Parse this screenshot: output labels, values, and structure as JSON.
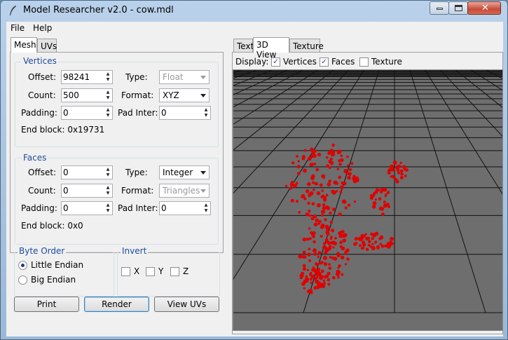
{
  "window": {
    "title": "Model Researcher v2.0 - cow.mdl"
  },
  "menu": {
    "file": "File",
    "help": "Help"
  },
  "left_tabs": {
    "mesh": "Mesh",
    "uvs": "UVs"
  },
  "vertices": {
    "group_label": "Vertices",
    "offset_label": "Offset:",
    "offset_value": "98241",
    "count_label": "Count:",
    "count_value": "500",
    "padding_label": "Padding:",
    "padding_value": "0",
    "type_label": "Type:",
    "type_value": "Float",
    "format_label": "Format:",
    "format_value": "XYZ",
    "padinter_label": "Pad Inter:",
    "padinter_value": "0",
    "endblock_text": "End block: 0x19731"
  },
  "faces": {
    "group_label": "Faces",
    "offset_label": "Offset:",
    "offset_value": "0",
    "count_label": "Count:",
    "count_value": "0",
    "padding_label": "Padding:",
    "padding_value": "0",
    "type_label": "Type:",
    "type_value": "Integer",
    "format_label": "Format:",
    "format_value": "Triangles",
    "padinter_label": "Pad Inter:",
    "padinter_value": "0",
    "endblock_text": "End block: 0x0"
  },
  "byte_order": {
    "group_label": "Byte Order",
    "little": "Little Endian",
    "big": "Big Endian",
    "selected": "little"
  },
  "invert": {
    "group_label": "Invert",
    "x": "X",
    "y": "Y",
    "z": "Z"
  },
  "buttons": {
    "print": "Print",
    "render": "Render",
    "view_uvs": "View UVs"
  },
  "right_tabs": {
    "text": "Text",
    "view3d": "3D View",
    "texture": "Texture"
  },
  "display": {
    "label": "Display:",
    "vertices": "Vertices",
    "faces": "Faces",
    "texture": "Texture"
  },
  "checks": {
    "vertices": true,
    "faces": true,
    "texture": false,
    "invert_x": false,
    "invert_y": false,
    "invert_z": false
  },
  "colors": {
    "point": "#e00000",
    "grid_line": "#111111",
    "floor": "#6e6e6e",
    "group_label": "#1c4b9c"
  },
  "icons": {
    "app": "quill-icon",
    "minimize": "minimize-icon",
    "maximize": "maximize-icon",
    "close": "close-icon"
  }
}
